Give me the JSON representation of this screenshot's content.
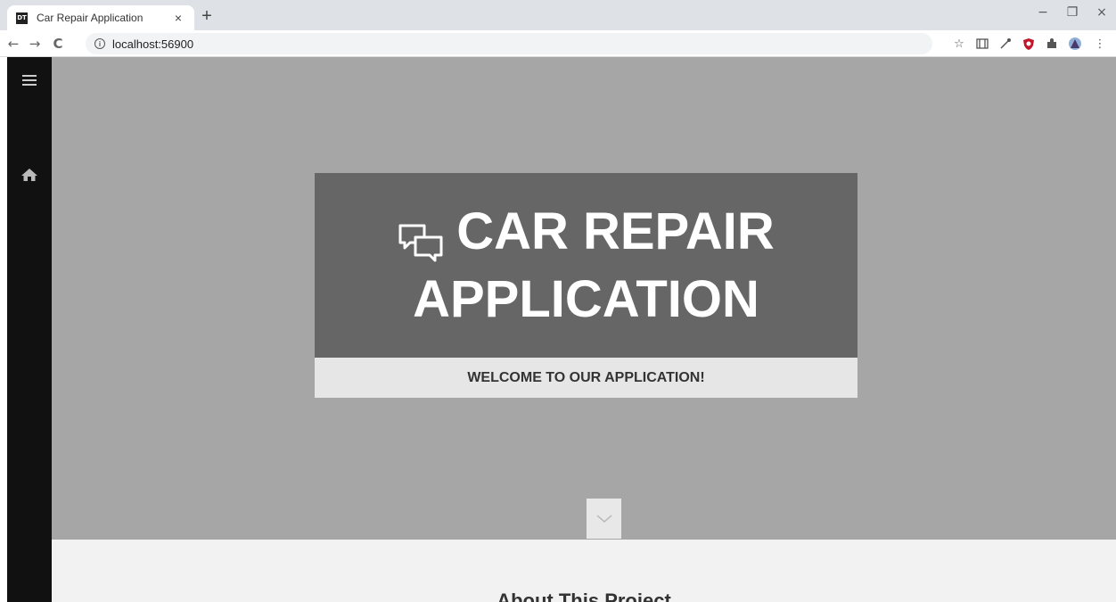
{
  "browser": {
    "tab_title": "Car Repair Application",
    "favicon_text": "DT",
    "tab_close": "×",
    "new_tab": "+",
    "url": "localhost:56900",
    "window_controls": {
      "minimize": "−",
      "maximize": "❐",
      "close": "×"
    },
    "nav": {
      "back": "←",
      "forward": "→",
      "reload": "C"
    },
    "extensions": [
      "star-icon",
      "cast-icon",
      "eyedropper-icon",
      "shield-icon",
      "puzzle-icon",
      "avatar-icon",
      "menu-icon"
    ]
  },
  "sidebar": {
    "items": [
      {
        "icon": "hamburger-icon"
      },
      {
        "icon": "home-icon"
      }
    ]
  },
  "hero": {
    "icon": "chat-bubbles-icon",
    "title_line1": "CAR REPAIR",
    "title_line2": "APPLICATION",
    "welcome": "WELCOME TO OUR APPLICATION!",
    "scroll_icon": "chevron-down-icon"
  },
  "about": {
    "title": "About This Project"
  },
  "colors": {
    "sidebar": "#111111",
    "hero_bg": "#a6a6a6",
    "hero_box": "#666666",
    "welcome_bar": "#e6e6e6",
    "about_bg": "#f2f2f2"
  }
}
